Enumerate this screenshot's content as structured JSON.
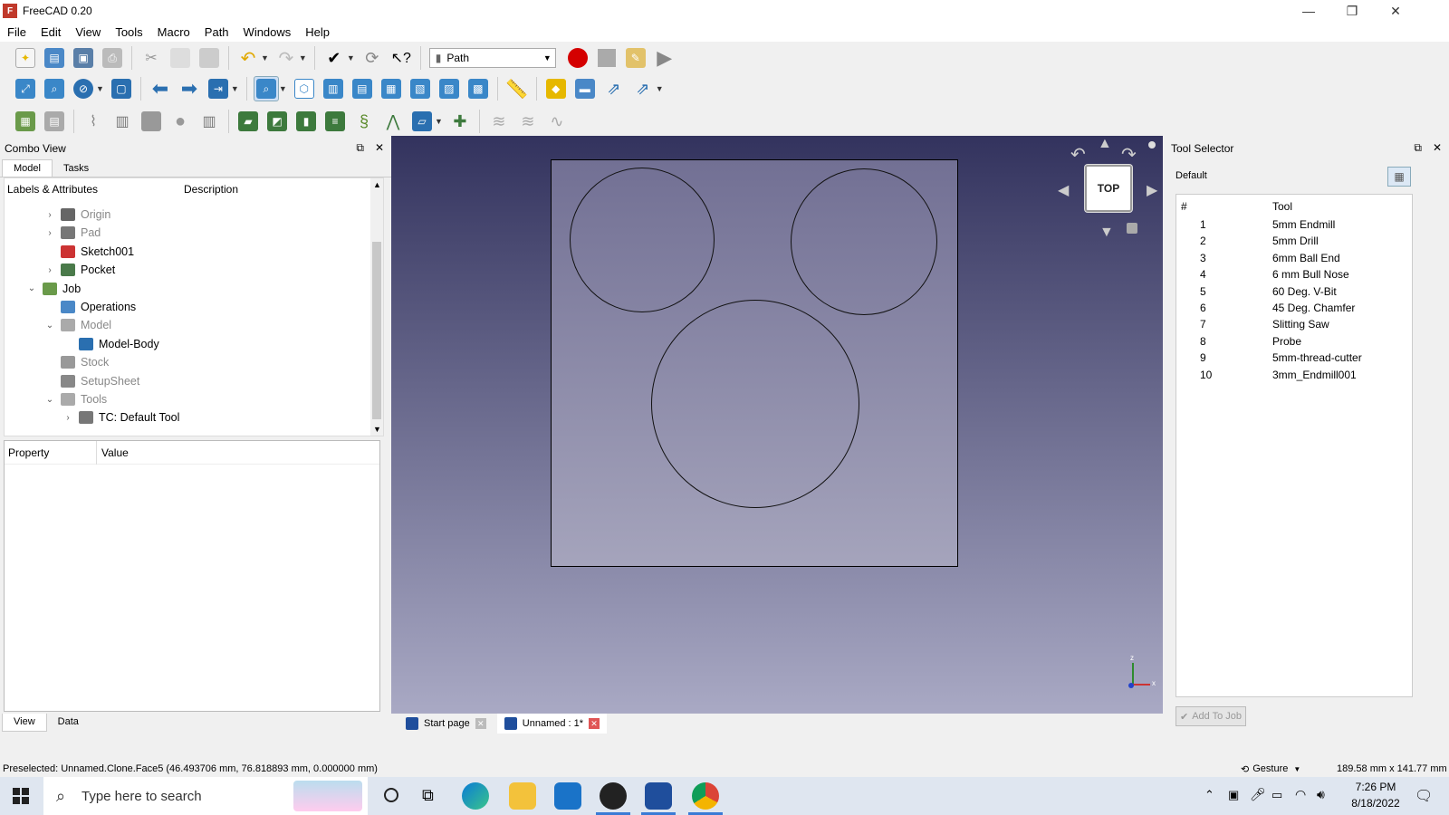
{
  "window": {
    "title": "FreeCAD 0.20",
    "minimize": "—",
    "restore": "❐",
    "close": "✕"
  },
  "menu": [
    "File",
    "Edit",
    "View",
    "Tools",
    "Macro",
    "Path",
    "Windows",
    "Help"
  ],
  "workbench": {
    "selected": "Path"
  },
  "combo": {
    "title": "Combo View",
    "tabs": [
      "Model",
      "Tasks"
    ],
    "tree_headers": {
      "labels": "Labels & Attributes",
      "description": "Description"
    },
    "tree": [
      {
        "label": "Origin",
        "twisty": "›",
        "gray": true
      },
      {
        "label": "Pad",
        "twisty": "›",
        "gray": true
      },
      {
        "label": "Sketch001",
        "twisty": "",
        "gray": false
      },
      {
        "label": "Pocket",
        "twisty": "›",
        "gray": false
      },
      {
        "label": "Job",
        "twisty": "⌄",
        "gray": false
      },
      {
        "label": "Operations",
        "twisty": "",
        "gray": false
      },
      {
        "label": "Model",
        "twisty": "⌄",
        "gray": true
      },
      {
        "label": "Model-Body",
        "twisty": "",
        "gray": false
      },
      {
        "label": "Stock",
        "twisty": "",
        "gray": true
      },
      {
        "label": "SetupSheet",
        "twisty": "",
        "gray": true
      },
      {
        "label": "Tools",
        "twisty": "⌄",
        "gray": true
      },
      {
        "label": "TC: Default Tool",
        "twisty": "›",
        "gray": false
      }
    ],
    "prop_headers": {
      "property": "Property",
      "value": "Value"
    },
    "bottom_tabs": [
      "View",
      "Data"
    ]
  },
  "viewport": {
    "navcube_face": "TOP",
    "axes": {
      "x": "x",
      "y": "y",
      "z": "z"
    }
  },
  "doc_tabs": [
    {
      "label": "Start page",
      "active": false
    },
    {
      "label": "Unnamed : 1*",
      "active": true
    }
  ],
  "tool_selector": {
    "title": "Tool Selector",
    "library": "Default",
    "col_num": "#",
    "col_tool": "Tool",
    "tools": [
      {
        "n": "1",
        "name": "5mm Endmill"
      },
      {
        "n": "2",
        "name": "5mm Drill"
      },
      {
        "n": "3",
        "name": "6mm Ball End"
      },
      {
        "n": "4",
        "name": "6 mm Bull Nose"
      },
      {
        "n": "5",
        "name": "60 Deg. V-Bit"
      },
      {
        "n": "6",
        "name": "45 Deg. Chamfer"
      },
      {
        "n": "7",
        "name": "Slitting Saw"
      },
      {
        "n": "8",
        "name": "Probe"
      },
      {
        "n": "9",
        "name": "5mm-thread-cutter"
      },
      {
        "n": "10",
        "name": "3mm_Endmill001"
      }
    ],
    "add_button": "Add To Job"
  },
  "status": {
    "preselected": "Preselected: Unnamed.Clone.Face5 (46.493706 mm, 76.818893 mm, 0.000000 mm)",
    "nav_style": "Gesture",
    "dimensions": "189.58 mm x 141.77 mm"
  },
  "taskbar": {
    "search_placeholder": "Type here to search",
    "time": "7:26 PM",
    "date": "8/18/2022"
  },
  "colors": {
    "record": "#d40000",
    "viewport_top": "#33335e",
    "viewport_bottom": "#a9a9c4"
  }
}
